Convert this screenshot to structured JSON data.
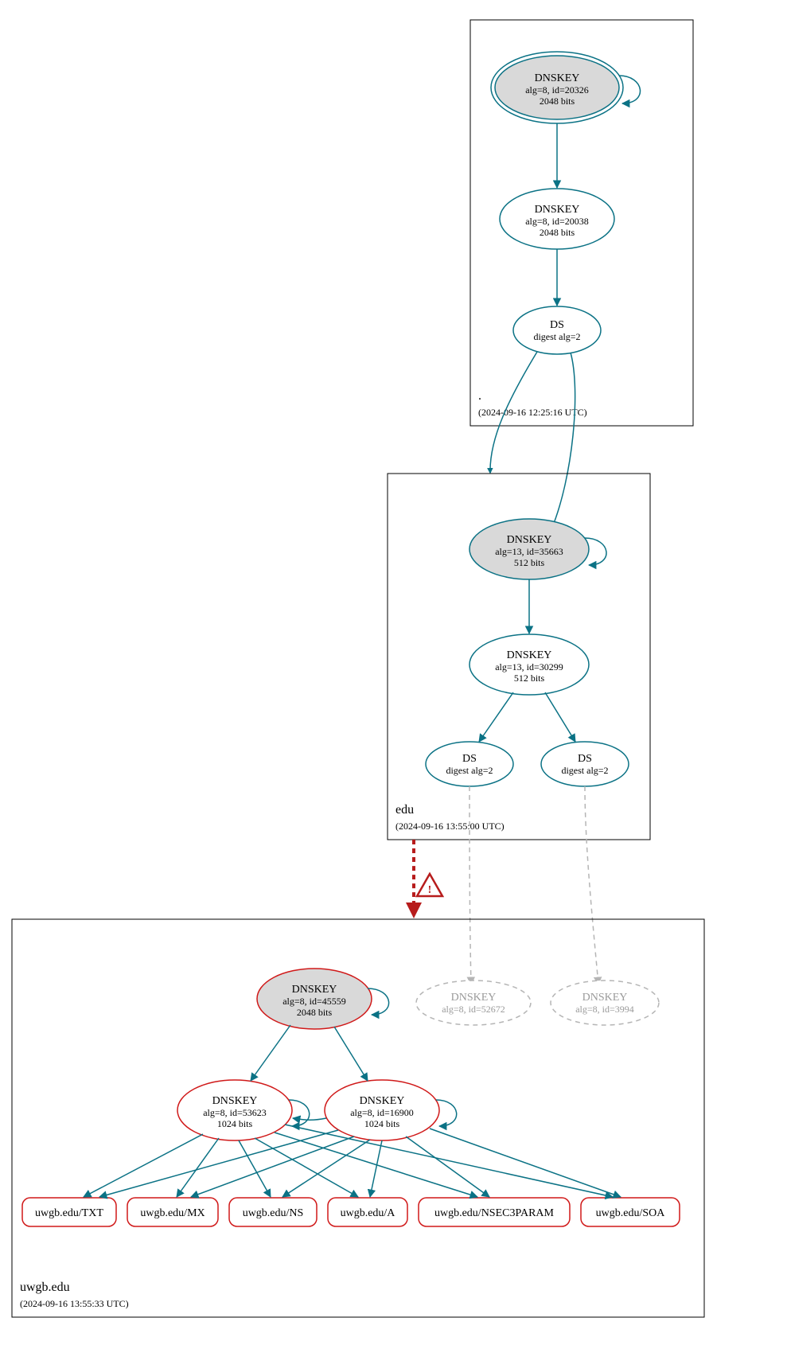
{
  "zones": {
    "root": {
      "name": ".",
      "timestamp": "(2024-09-16 12:25:16 UTC)",
      "dnskey1": {
        "title": "DNSKEY",
        "line1": "alg=8, id=20326",
        "line2": "2048 bits"
      },
      "dnskey2": {
        "title": "DNSKEY",
        "line1": "alg=8, id=20038",
        "line2": "2048 bits"
      },
      "ds": {
        "title": "DS",
        "line1": "digest alg=2"
      }
    },
    "edu": {
      "name": "edu",
      "timestamp": "(2024-09-16 13:55:00 UTC)",
      "dnskey1": {
        "title": "DNSKEY",
        "line1": "alg=13, id=35663",
        "line2": "512 bits"
      },
      "dnskey2": {
        "title": "DNSKEY",
        "line1": "alg=13, id=30299",
        "line2": "512 bits"
      },
      "ds1": {
        "title": "DS",
        "line1": "digest alg=2"
      },
      "ds2": {
        "title": "DS",
        "line1": "digest alg=2"
      }
    },
    "uwgb": {
      "name": "uwgb.edu",
      "timestamp": "(2024-09-16 13:55:33 UTC)",
      "dnskey_ksk": {
        "title": "DNSKEY",
        "line1": "alg=8, id=45559",
        "line2": "2048 bits"
      },
      "dnskey_missing1": {
        "title": "DNSKEY",
        "line1": "alg=8, id=52672"
      },
      "dnskey_missing2": {
        "title": "DNSKEY",
        "line1": "alg=8, id=3994"
      },
      "dnskey_zsk1": {
        "title": "DNSKEY",
        "line1": "alg=8, id=53623",
        "line2": "1024 bits"
      },
      "dnskey_zsk2": {
        "title": "DNSKEY",
        "line1": "alg=8, id=16900",
        "line2": "1024 bits"
      },
      "rrsets": {
        "txt": "uwgb.edu/TXT",
        "mx": "uwgb.edu/MX",
        "ns": "uwgb.edu/NS",
        "a": "uwgb.edu/A",
        "nsec3": "uwgb.edu/NSEC3PARAM",
        "soa": "uwgb.edu/SOA"
      }
    }
  },
  "warning_icon": "⚠"
}
